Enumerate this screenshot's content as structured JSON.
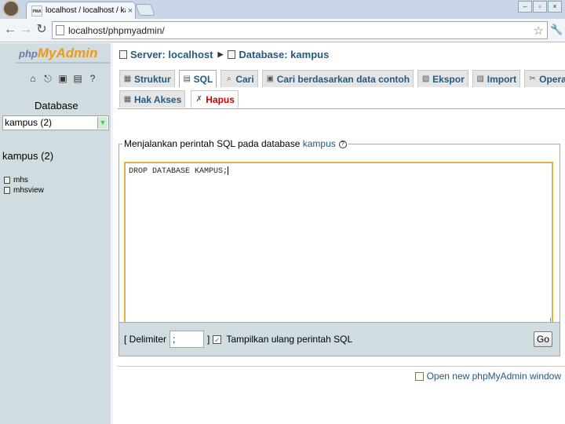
{
  "browser": {
    "tab_title": "localhost / localhost / kampus",
    "favicon_text": "PMA",
    "url": "localhost/phpmyadmin/"
  },
  "left": {
    "logo_a": "php",
    "logo_b": "MyAdmin",
    "db_label": "Database",
    "db_select_value": "kampus (2)",
    "db_title": "kampus (2)",
    "tables": [
      "mhs",
      "mhsview"
    ]
  },
  "breadcrumb": {
    "server": "Server: localhost",
    "database": "Database: kampus"
  },
  "tabs": {
    "row1": [
      "Struktur",
      "SQL",
      "Cari",
      "Cari berdasarkan data contoh",
      "Ekspor",
      "Import",
      "Operasi"
    ],
    "row2": [
      "Hak Akses",
      "Hapus"
    ]
  },
  "sql": {
    "legend_text": "Menjalankan perintah SQL pada database",
    "legend_db": "kampus",
    "query": "DROP DATABASE KAMPUS;"
  },
  "footer": {
    "delimiter_label": "[ Delimiter",
    "delimiter_value": ";",
    "bracket_close": "]",
    "show_query_label": "Tampilkan ulang perintah SQL",
    "go_label": "Go"
  },
  "new_window_link": "Open new phpMyAdmin window"
}
